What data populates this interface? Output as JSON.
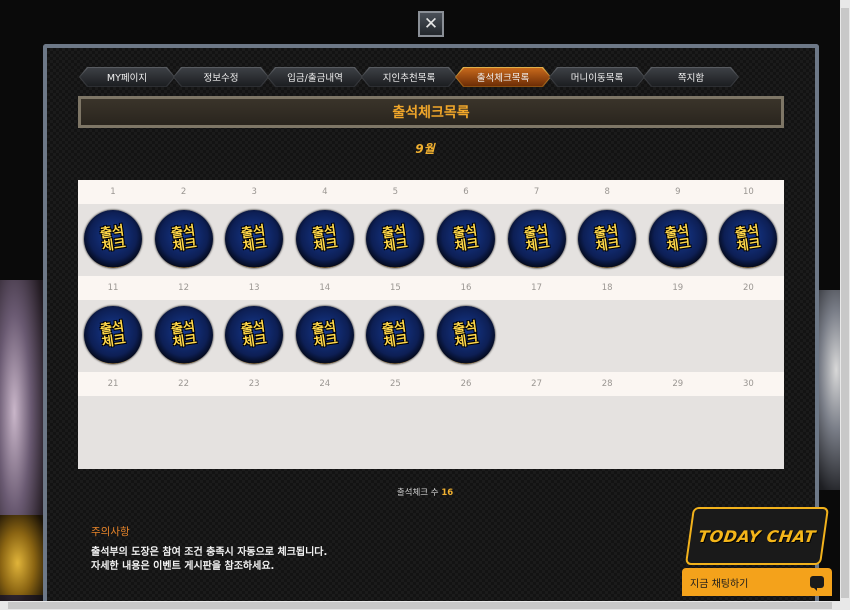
{
  "close_glyph": "✕",
  "tabs": [
    {
      "label": "MY페이지",
      "active": false
    },
    {
      "label": "정보수정",
      "active": false
    },
    {
      "label": "입금/출금내역",
      "active": false
    },
    {
      "label": "지인추천목록",
      "active": false
    },
    {
      "label": "출석체크목록",
      "active": true
    },
    {
      "label": "머니이동목록",
      "active": false
    },
    {
      "label": "쪽지함",
      "active": false
    }
  ],
  "page_title": "출석체크목록",
  "month_label": "9월",
  "calendar": {
    "stamp_text": "출석\n체크",
    "rows": [
      {
        "days": [
          "1",
          "2",
          "3",
          "4",
          "5",
          "6",
          "7",
          "8",
          "9",
          "10"
        ],
        "checked": [
          true,
          true,
          true,
          true,
          true,
          true,
          true,
          true,
          true,
          true
        ]
      },
      {
        "days": [
          "11",
          "12",
          "13",
          "14",
          "15",
          "16",
          "17",
          "18",
          "19",
          "20"
        ],
        "checked": [
          true,
          true,
          true,
          true,
          true,
          true,
          false,
          false,
          false,
          false
        ]
      },
      {
        "days": [
          "21",
          "22",
          "23",
          "24",
          "25",
          "26",
          "27",
          "28",
          "29",
          "30"
        ],
        "checked": [
          false,
          false,
          false,
          false,
          false,
          false,
          false,
          false,
          false,
          false
        ]
      }
    ]
  },
  "count": {
    "label": "출석체크 수",
    "value": "16"
  },
  "notice": {
    "title": "주의사항",
    "lines": [
      "출석부의 도장은 참여 조건 충족시 자동으로 체크됩니다.",
      "자세한 내용은 이벤트 게시판을 참조하세요."
    ]
  },
  "chat": {
    "logo_text": "TODAY CHAT",
    "button_label": "지금 채팅하기"
  },
  "colors": {
    "accent": "#f0a62a",
    "frame": "#6d7887",
    "chat": "#f4a21b"
  }
}
